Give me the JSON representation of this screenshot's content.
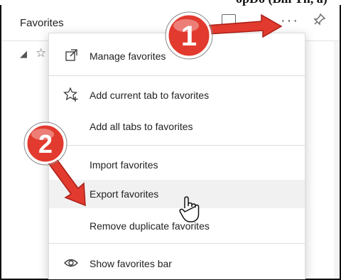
{
  "page": {
    "cropped_header_text": "opDo (Bill Th, a)"
  },
  "panel": {
    "title": "Favorites",
    "icons": {
      "folder": "folder-add-icon",
      "more": "more-options-icon",
      "more_glyph": "···",
      "pin": "pin-icon"
    }
  },
  "tree": {
    "expand_glyph": "◢",
    "star_glyph": "☆"
  },
  "menu": {
    "items": [
      {
        "label": "Manage favorites",
        "icon": "open-external-icon"
      },
      {
        "label": "Add current tab to favorites",
        "icon": "star-add-icon"
      },
      {
        "label": "Add all tabs to favorites",
        "icon": ""
      },
      {
        "label": "Import favorites",
        "icon": ""
      },
      {
        "label": "Export favorites",
        "icon": ""
      },
      {
        "label": "Remove duplicate favorites",
        "icon": ""
      },
      {
        "label": "Show favorites bar",
        "icon": "eye-icon"
      }
    ]
  },
  "callouts": [
    {
      "number": "1",
      "color": "#e23a2e"
    },
    {
      "number": "2",
      "color": "#e23a2e"
    }
  ],
  "colors": {
    "callout": "#e23a2e",
    "hover": "#f1f1f1"
  }
}
